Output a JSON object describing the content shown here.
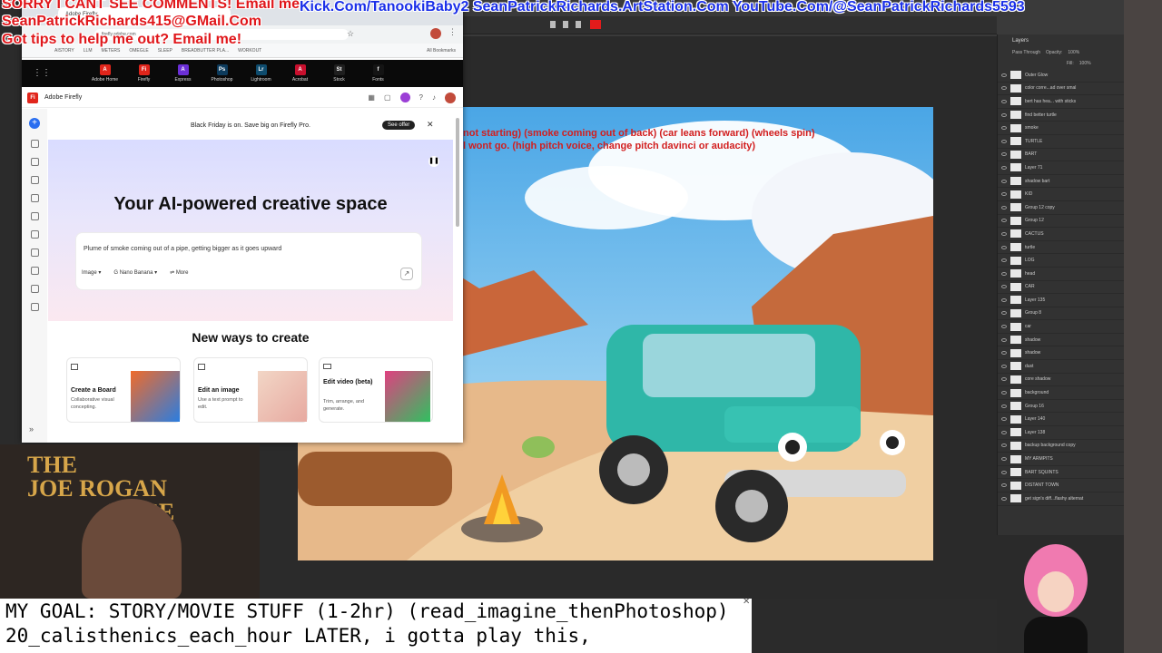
{
  "overlay": {
    "line1": "SORRY I CANT SEE COMMENTS! Email me:",
    "line2": "SeanPatrickRichards415@GMail.Com",
    "line3": "Got tips to help me out? Email me!",
    "links": "Kick.Com/TanookiBaby2 SeanPatrickRichards.ArtStation.Com YouTube.Com/@SeanPatrickRichards5593",
    "colors": {
      "red": "#e0171b",
      "blue": "#1a2fe8"
    }
  },
  "browser": {
    "tab_title": "Adobe Firefly",
    "url": "firefly.adobe.com",
    "bookmarks": [
      "AISTORY",
      "LLM",
      "METERS",
      "OMEGLE",
      "SLEEP",
      "BREADBUTTER PLA...",
      "WORKOUT"
    ],
    "all_bookmarks": "All Bookmarks"
  },
  "adobe_nav": {
    "apps": [
      {
        "label": "Adobe Home",
        "abbr": "A",
        "color": "#e1251b"
      },
      {
        "label": "Firefly",
        "abbr": "Fi",
        "color": "#e1251b"
      },
      {
        "label": "Express",
        "abbr": "A",
        "color": "#6b2fd6"
      },
      {
        "label": "Photoshop",
        "abbr": "Ps",
        "color": "#0d3b5c"
      },
      {
        "label": "Lightroom",
        "abbr": "Lr",
        "color": "#0e4c6e"
      },
      {
        "label": "Acrobat",
        "abbr": "A",
        "color": "#c8102e"
      },
      {
        "label": "Stock",
        "abbr": "St",
        "color": "#1f1f1f"
      },
      {
        "label": "Fonts",
        "abbr": "f",
        "color": "#141414"
      }
    ]
  },
  "firefly": {
    "brand": "Adobe Firefly",
    "promo_text": "Black Friday is on. Save big on Firefly Pro.",
    "promo_button": "See offer",
    "hero_title": "Your AI-powered creative space",
    "prompt_text": "Plume of smoke coming out of a pipe, getting bigger as it goes upward",
    "mode": "Image",
    "model": "Nano Banana",
    "more": "More",
    "section_title": "New ways to create",
    "cards": [
      {
        "title": "Create a Board",
        "desc": "Collaborative visual concepting."
      },
      {
        "title": "Edit an image",
        "desc": "Use a text prompt to edit."
      },
      {
        "title": "Edit video (beta)",
        "desc": "Trim, arrange, and generate."
      }
    ]
  },
  "artwork": {
    "note1": "not starting) (smoke coming out of back) (car leans forward) (wheels spin)",
    "note2": "l wont go. (high pitch voice, change pitch davinci or audacity)"
  },
  "layers": {
    "title": "Layers",
    "blend": "Pass Through",
    "opacity_label": "Opacity:",
    "opacity": "100%",
    "fill_label": "Fill:",
    "fill": "100%",
    "items": [
      "Outer Glow",
      "color corre...ad over smal",
      "bert has hea... with sticks",
      "find better turtle",
      "smoke",
      "TURTLE",
      "BART",
      "Layer 71",
      "shadow bart",
      "KID",
      "Group 12 copy",
      "Group 12",
      "CACTUS",
      "turtle",
      "LOG",
      "head",
      "CAR",
      "Layer 135",
      "Group 8",
      "car",
      "shadow",
      "shadow",
      "dust",
      "core shadow",
      "background",
      "Group 16",
      "Layer 140",
      "Layer 138",
      "backup background copy",
      "MY ARMPITS",
      "BART SQUINTS",
      "DISTANT TOWN",
      "get sign's diff...flashy alternat"
    ]
  },
  "webcam": {
    "sign_line1": "THE",
    "sign_line2": "JOE ROGAN",
    "sign_line3": "ENCE"
  },
  "caption": {
    "line1": "MY GOAL: STORY/MOVIE STUFF (1-2hr) (read_imagine_thenPhotoshop)",
    "line2": "20_calisthenics_each_hour  LATER, i gotta play this,"
  }
}
